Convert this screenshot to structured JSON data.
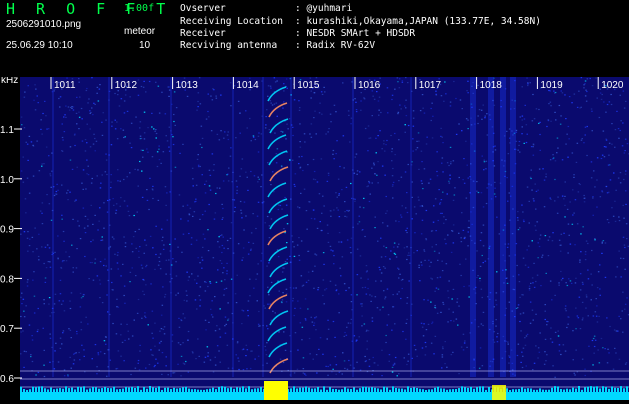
{
  "header": {
    "app_name": "HROFFT",
    "version": "1.00f",
    "filename": "2506291010.png",
    "mode": "meteor",
    "datetime": "25.06.29 10:10",
    "count": "10",
    "info": [
      {
        "label": "Ovserver",
        "value": ": @yuhmari"
      },
      {
        "label": "Receiving Location",
        "value": ": kurashiki,Okayama,JAPAN (133.77E, 34.58N)"
      },
      {
        "label": "Receiver",
        "value": ": NESDR SMArt + HDSDR"
      },
      {
        "label": "Recviving antenna",
        "value": ": Radix RV-62V"
      }
    ]
  },
  "spectrogram": {
    "y_unit": "kHz",
    "x_ticks": [
      "1011",
      "1012",
      "1013",
      "1014",
      "1015",
      "1016",
      "1017",
      "1018",
      "1019",
      "1020"
    ],
    "y_ticks": [
      "1.1",
      "1.0",
      "0.9",
      "0.8",
      "0.7",
      "0.6"
    ],
    "colors": {
      "background": "#0a0a6e",
      "noise": "#1e3cff",
      "signal": "#00d8ff",
      "strong": "#ffff00",
      "axis": "#ffffff"
    }
  }
}
